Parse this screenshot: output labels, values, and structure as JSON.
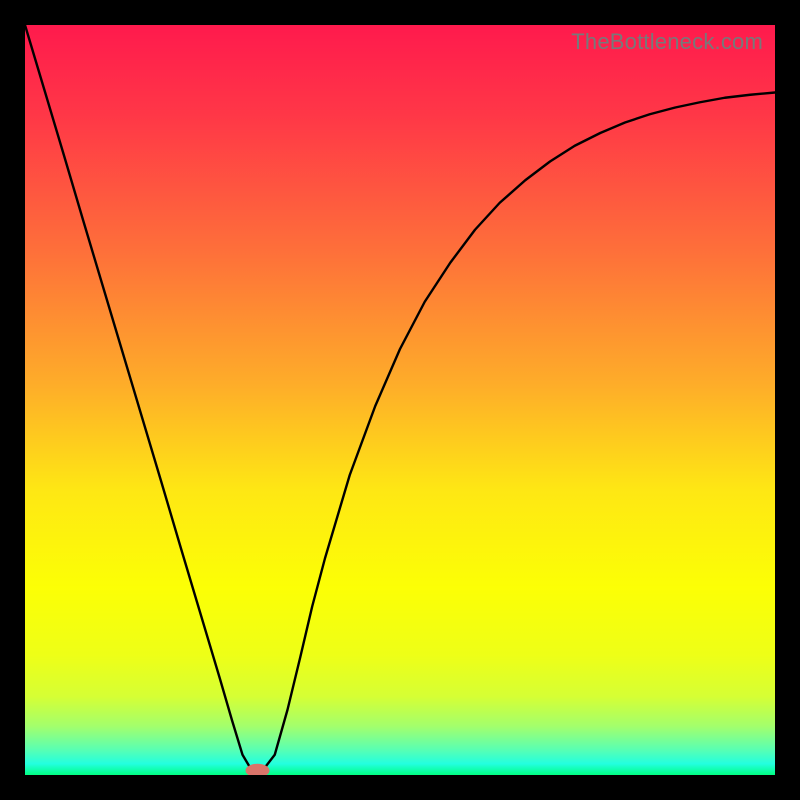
{
  "watermark": "TheBottleneck.com",
  "chart_data": {
    "type": "line",
    "title": "",
    "xlabel": "",
    "ylabel": "",
    "xlim": [
      0,
      100
    ],
    "ylim": [
      0,
      100
    ],
    "gradient_stops": [
      {
        "offset": 0.0,
        "color": "#ff1a4d"
      },
      {
        "offset": 0.12,
        "color": "#ff3747"
      },
      {
        "offset": 0.3,
        "color": "#fe6f3a"
      },
      {
        "offset": 0.48,
        "color": "#fead29"
      },
      {
        "offset": 0.62,
        "color": "#fee714"
      },
      {
        "offset": 0.75,
        "color": "#fcff05"
      },
      {
        "offset": 0.84,
        "color": "#eeff17"
      },
      {
        "offset": 0.895,
        "color": "#d6ff34"
      },
      {
        "offset": 0.935,
        "color": "#a3ff6c"
      },
      {
        "offset": 0.965,
        "color": "#5cffb0"
      },
      {
        "offset": 0.985,
        "color": "#23ffdf"
      },
      {
        "offset": 1.0,
        "color": "#00ff83"
      }
    ],
    "series": [
      {
        "name": "bottleneck-curve",
        "x": [
          0.0,
          2.6,
          5.2,
          7.8,
          10.4,
          13.0,
          15.6,
          18.2,
          20.8,
          23.4,
          26.0,
          27.6,
          29.0,
          30.3,
          31.6,
          33.3,
          35.0,
          36.7,
          38.3,
          40.0,
          43.3,
          46.7,
          50.0,
          53.3,
          56.7,
          60.0,
          63.3,
          66.7,
          70.0,
          73.3,
          76.7,
          80.0,
          83.3,
          86.7,
          90.0,
          93.3,
          96.7,
          100.0
        ],
        "y": [
          100.0,
          91.3,
          82.6,
          73.8,
          65.1,
          56.4,
          47.7,
          39.0,
          30.2,
          21.5,
          12.8,
          7.3,
          2.7,
          0.5,
          0.5,
          2.7,
          8.7,
          15.7,
          22.5,
          28.9,
          40.0,
          49.2,
          56.8,
          63.1,
          68.3,
          72.7,
          76.3,
          79.3,
          81.8,
          83.9,
          85.6,
          87.0,
          88.1,
          89.0,
          89.7,
          90.3,
          90.7,
          91.0
        ]
      }
    ],
    "marker": {
      "x": 31.0,
      "y": 0.6,
      "rx": 1.6,
      "ry": 0.9,
      "color": "#d9746a"
    }
  }
}
